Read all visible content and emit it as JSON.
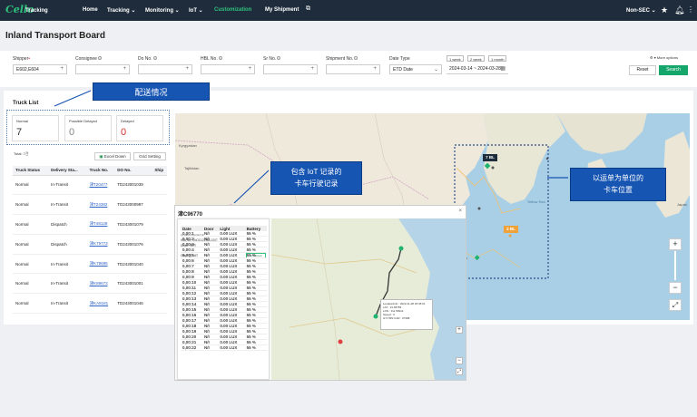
{
  "nav": {
    "logo": "Cello",
    "logo_sub": "Tracking",
    "items": [
      "Home",
      "Tracking",
      "Monitoring",
      "IoT",
      "Customization",
      "My Shipment"
    ],
    "account": "Non-SEC"
  },
  "page": {
    "title": "Inland Transport Board"
  },
  "filters": {
    "shipper_label": "Shipper",
    "shipper_value": "E602,E604",
    "consignee_label": "Consignee",
    "do_label": "Do No.",
    "hbl_label": "HBL No.",
    "sr_label": "Sr No.",
    "shipment_label": "Shipment No.",
    "date_type_label": "Date Type",
    "date_type_value": "ETD Date",
    "date_range": "2024-03-14 ~ 2024-03-28",
    "quick": [
      "1 week",
      "2 week",
      "1 month"
    ],
    "more_options": "More options",
    "reset": "Reset",
    "search": "Search"
  },
  "truck_list": {
    "title": "Truck List",
    "summary": [
      {
        "label": "Normal",
        "value": "7"
      },
      {
        "label": "Possible Delayed",
        "value": "0"
      },
      {
        "label": "Delayed",
        "value": "0"
      }
    ],
    "total": "Total: 7건",
    "excel": "Excel Down",
    "grid": "Grid Setting",
    "columns": [
      "Truck Status",
      "Delivery Sta...",
      "Truck No.",
      "DO No.",
      "Ship"
    ],
    "rows": [
      [
        "Normal",
        "In-Transit",
        "津T20477",
        "TD243001039"
      ],
      [
        "Normal",
        "In-Transit",
        "津T24382",
        "TD243000987"
      ],
      [
        "Normal",
        "Dispatch",
        "津T48128",
        "TD243001079"
      ],
      [
        "Normal",
        "Dispatch",
        "津K79773",
        "TD243001076"
      ],
      [
        "Normal",
        "In-Transit",
        "津K79695",
        "TD243001040"
      ],
      [
        "Normal",
        "In-Transit",
        "津K89673",
        "TD243001001"
      ],
      [
        "Normal",
        "In-Transit",
        "津KA8181",
        "TD243001046"
      ]
    ]
  },
  "callouts": {
    "delivery": "配送情况",
    "iot": "包含 IoT 记录的\n卡车行驶记录",
    "location": "以运单为单位的\n卡车位置"
  },
  "map": {
    "badges": [
      "7 BL",
      "2 BL"
    ],
    "labels": [
      "Kyrgyzstan",
      "Tajikistan",
      "Yellow Sea",
      "Japan"
    ]
  },
  "modal": {
    "title": "津C96770",
    "buttons": [
      "Mission",
      "Information",
      "OK"
    ],
    "history": {
      "title": "IoT History Detail",
      "info": [
        "DO No: 0053527F",
        "HBL No: CNQG12286L1Q07",
        "Driver: 李四"
      ],
      "tab": "Grid: 张 LAT",
      "download": "Grid Down",
      "columns": [
        "Date",
        "Door",
        "Light",
        "Battery"
      ],
      "rows": [
        [
          "0,00:1",
          "N/I",
          "0.00 LUX",
          "55 %"
        ],
        [
          "0,00:2",
          "N/I",
          "0.00 LUX",
          "55 %"
        ],
        [
          "0,00:3",
          "N/I",
          "0.00 LUX",
          "55 %"
        ],
        [
          "0,00:4",
          "N/I",
          "0.00 LUX",
          "55 %"
        ],
        [
          "0,00:5",
          "N/I",
          "0.00 LUX",
          "55 %"
        ],
        [
          "0,00:6",
          "N/I",
          "0.00 LUX",
          "55 %"
        ],
        [
          "0,00:7",
          "N/I",
          "0.00 LUX",
          "55 %"
        ],
        [
          "0,00:8",
          "N/I",
          "0.00 LUX",
          "55 %"
        ],
        [
          "0,00:9",
          "N/I",
          "0.00 LUX",
          "55 %"
        ],
        [
          "0,00:10",
          "N/I",
          "0.00 LUX",
          "55 %"
        ],
        [
          "0,00:11",
          "N/I",
          "0.00 LUX",
          "55 %"
        ],
        [
          "0,00:12",
          "N/I",
          "0.00 LUX",
          "55 %"
        ],
        [
          "0,00:13",
          "N/I",
          "0.00 LUX",
          "55 %"
        ],
        [
          "0,00:14",
          "N/I",
          "0.00 LUX",
          "55 %"
        ],
        [
          "0,00:15",
          "N/I",
          "0.00 LUX",
          "55 %"
        ],
        [
          "0,00:16",
          "N/I",
          "0.00 LUX",
          "55 %"
        ],
        [
          "0,00:17",
          "N/I",
          "0.00 LUX",
          "55 %"
        ],
        [
          "0,00:18",
          "N/I",
          "0.00 LUX",
          "55 %"
        ],
        [
          "0,00:19",
          "N/I",
          "0.00 LUX",
          "55 %"
        ],
        [
          "0,00:20",
          "N/I",
          "0.00 LUX",
          "55 %"
        ],
        [
          "0,00:21",
          "N/I",
          "0.00 LUX",
          "55 %"
        ],
        [
          "0,00:22",
          "N/I",
          "0.00 LUX",
          "55 %"
        ]
      ]
    },
    "info_box": [
      "LocationInfo : 2023-11-28 18:45:01",
      "LAT : 31.96755",
      "LON : 111.53914",
      "Speed : 0",
      "GT-TMS CAR : 07398"
    ]
  }
}
